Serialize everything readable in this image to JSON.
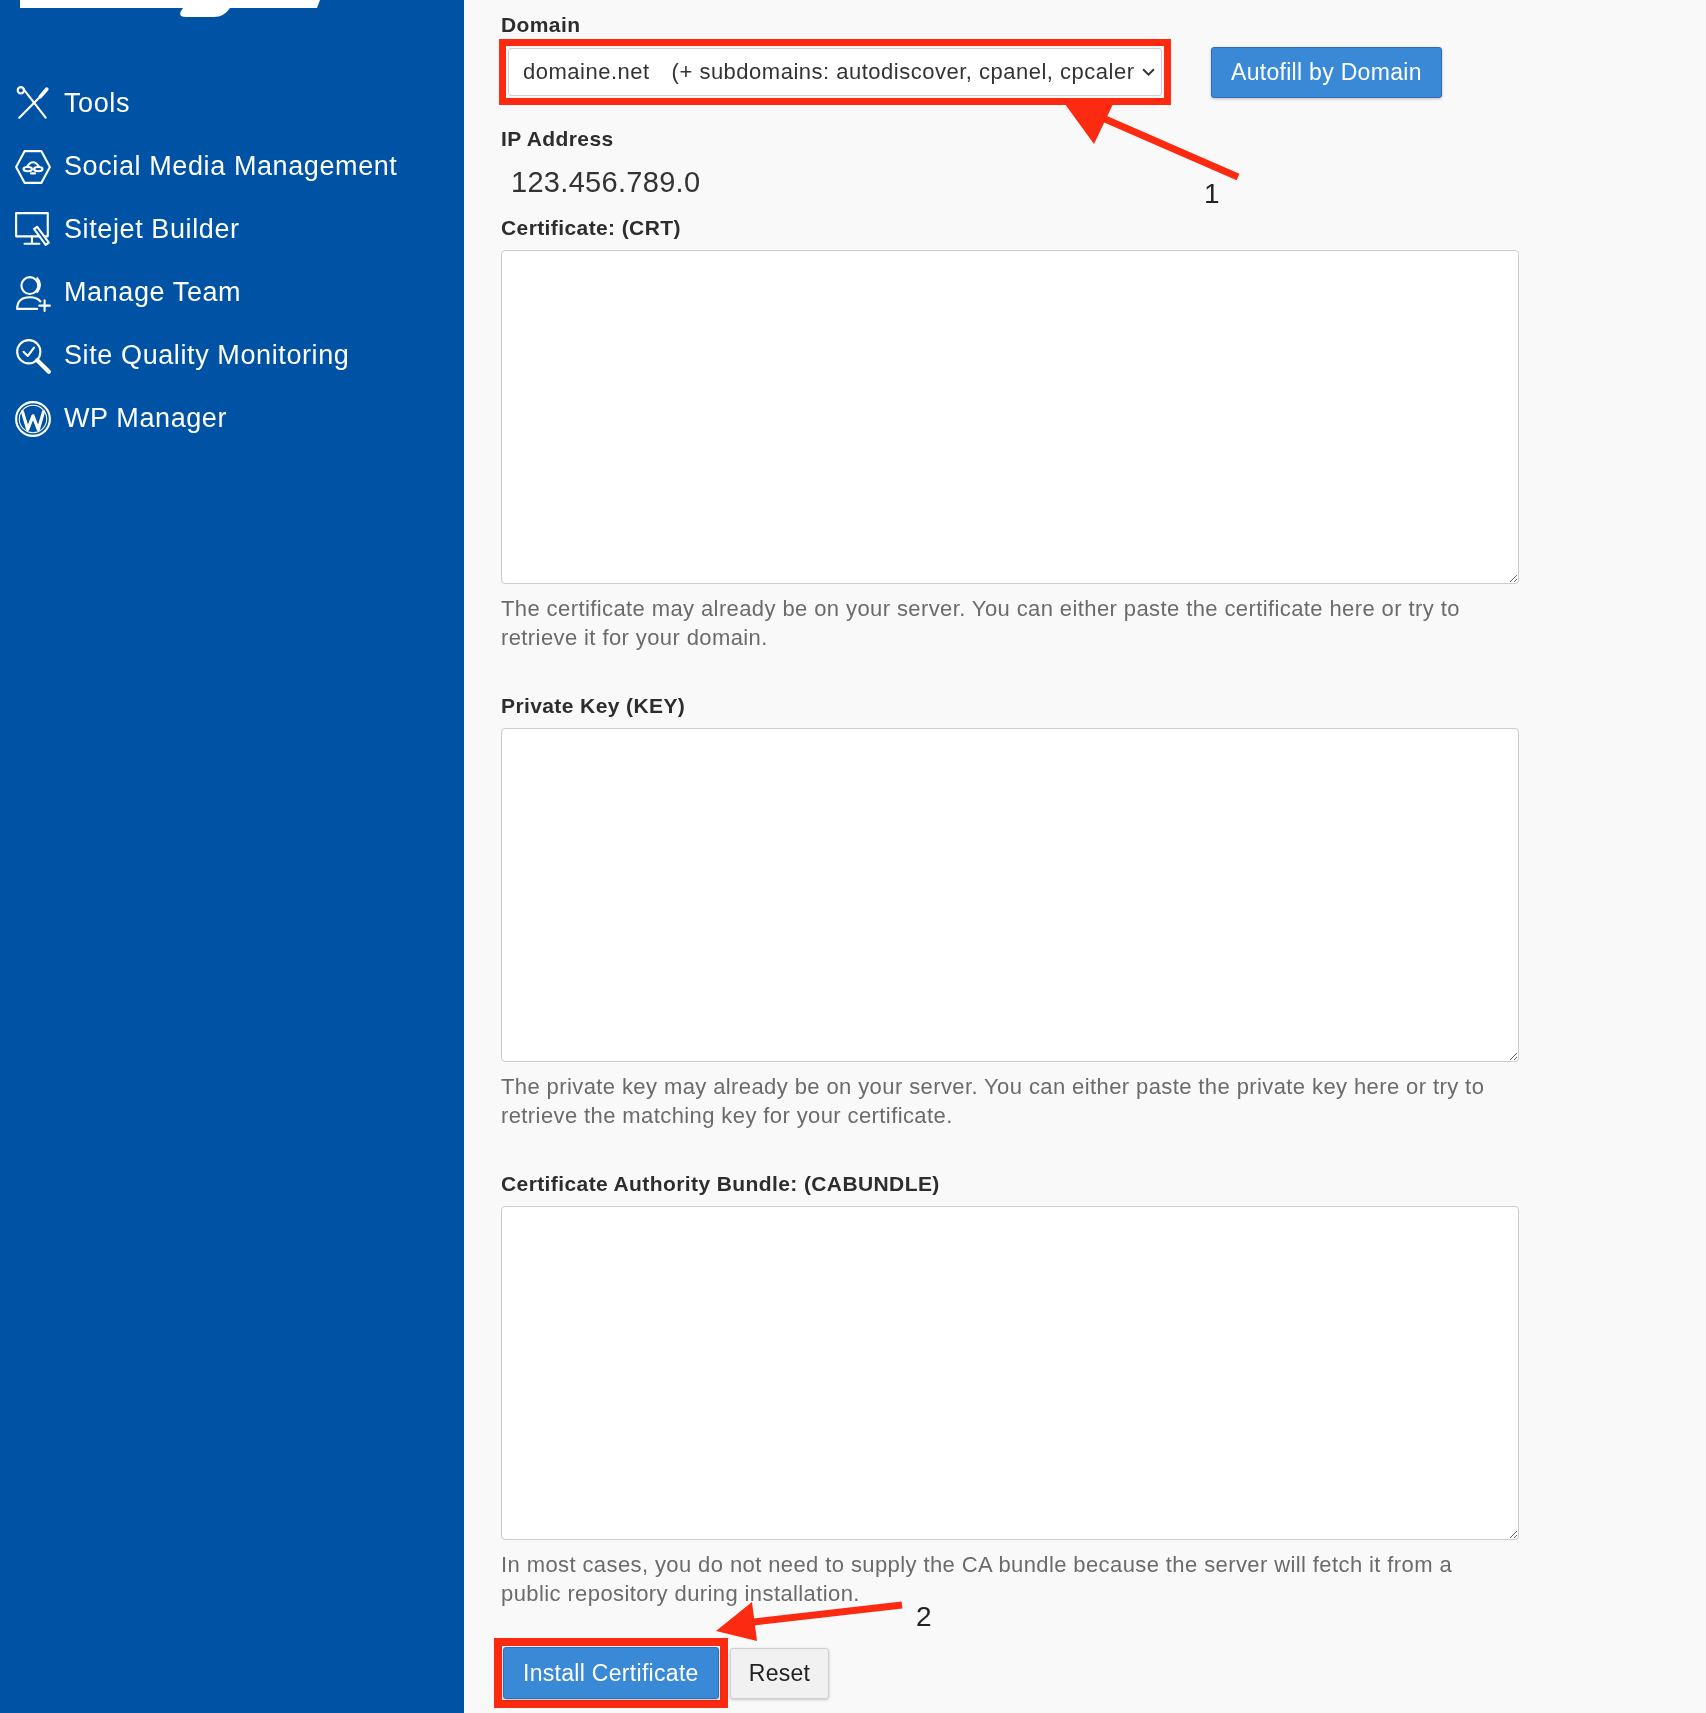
{
  "sidebar": {
    "items": [
      {
        "label": "Tools"
      },
      {
        "label": "Social Media Management"
      },
      {
        "label": "Sitejet Builder"
      },
      {
        "label": "Manage Team"
      },
      {
        "label": "Site Quality Monitoring"
      },
      {
        "label": "WP Manager"
      }
    ]
  },
  "domain": {
    "label": "Domain",
    "value": "domaine.net",
    "value_note": "(+ subdomains: autodiscover, cpanel, cpcaler",
    "highlighted": true,
    "button": "Autofill by Domain"
  },
  "ip_address": {
    "label": "IP Address",
    "value": "123.456.789.0"
  },
  "fields": [
    {
      "label": "Certificate: (CRT)",
      "help": "The certificate may already be on your server. You can either paste the certificate here or try to retrieve it for your domain."
    },
    {
      "label": "Private Key (KEY)",
      "help": "The private key may already be on your server. You can either paste the private key here or try to retrieve the matching key for your certificate."
    },
    {
      "label": "Certificate Authority Bundle: (CABUNDLE)",
      "help": "In most cases, you do not need to supply the CA bundle because the server will fetch it from a public repository during installation."
    }
  ],
  "actions": [
    {
      "label": "Install Certificate",
      "kind": "primary",
      "highlighted": true
    },
    {
      "label": "Reset",
      "kind": "secondary",
      "highlighted": false
    }
  ],
  "callouts": [
    {
      "label": "1"
    },
    {
      "label": "2"
    }
  ]
}
